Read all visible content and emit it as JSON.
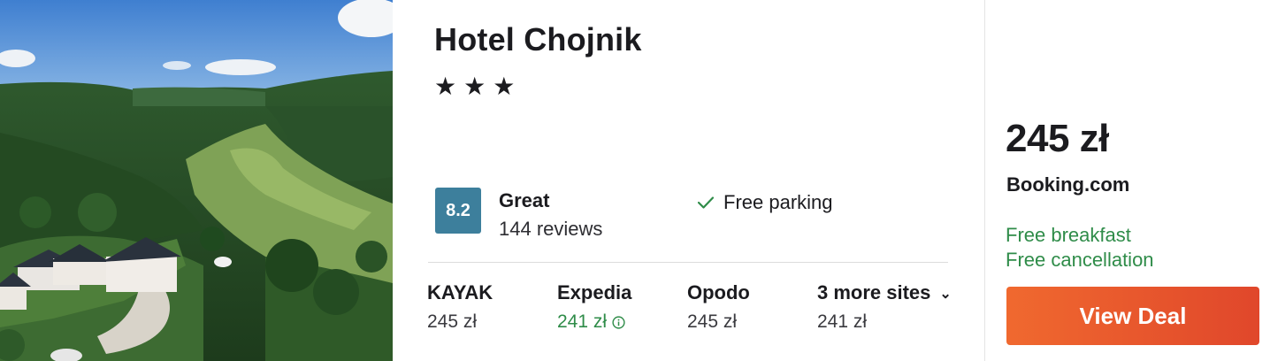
{
  "hotel": {
    "name": "Hotel Chojnik",
    "stars": 3
  },
  "rating": {
    "score": "8.2",
    "label": "Great",
    "reviews": "144 reviews",
    "badge_color": "#3d7f9c"
  },
  "amenities": [
    {
      "label": "Free parking",
      "icon": "check-icon"
    }
  ],
  "sites": [
    {
      "name": "KAYAK",
      "price": "245 zł"
    },
    {
      "name": "Expedia",
      "price": "241 zł",
      "price_color": "#2f8c49",
      "icon": "info-icon"
    },
    {
      "name": "Opodo",
      "price": "245 zł"
    },
    {
      "name": "3 more sites",
      "price": "241 zł",
      "icon": "chevron-down-icon"
    }
  ],
  "deal": {
    "price": "245 zł",
    "provider": "Booking.com",
    "perks": [
      "Free breakfast",
      "Free cancellation"
    ],
    "button_label": "View Deal",
    "perk_color": "#2f8c49",
    "button_color": "#e8572d"
  }
}
